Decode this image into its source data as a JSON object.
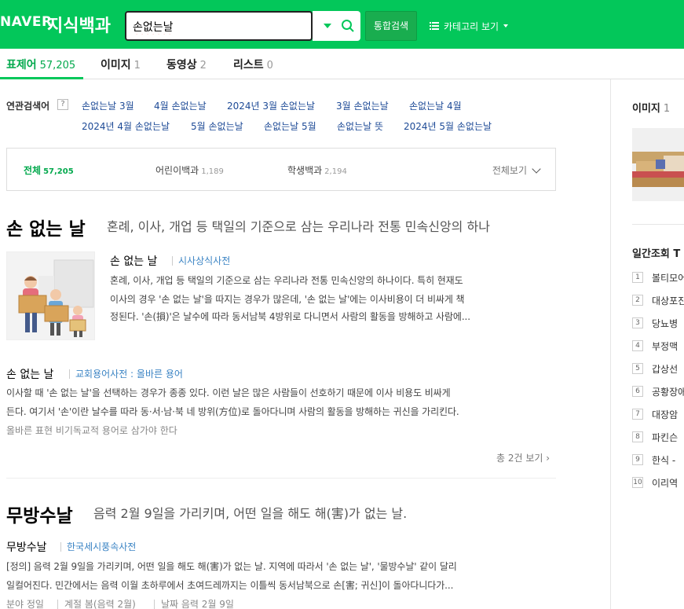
{
  "header": {
    "logo": "NAVER",
    "service": "지식백과",
    "search_value": "손없는날",
    "total_search_label": "통합검색",
    "category_label": "카테고리 보기"
  },
  "tabs": [
    {
      "label": "표제어",
      "count": "57,205"
    },
    {
      "label": "이미지",
      "count": "1"
    },
    {
      "label": "동영상",
      "count": "2"
    },
    {
      "label": "리스트",
      "count": "0"
    }
  ],
  "related": {
    "label": "연관검색어",
    "help": "?",
    "row1": [
      "손없는날 3월",
      "4월 손없는날",
      "2024년 3월 손없는날",
      "3월 손없는날",
      "손없는날 4월"
    ],
    "row2": [
      "2024년 4월 손없는날",
      "5월 손없는날",
      "손없는날 5월",
      "손없는날 뜻",
      "2024년 5월 손없는날"
    ]
  },
  "filter": {
    "items": [
      {
        "label": "전체",
        "count": "57,205"
      },
      {
        "label": "어린이백과",
        "count": "1,189"
      },
      {
        "label": "학생백과",
        "count": "2,194"
      }
    ],
    "view_all": "전체보기"
  },
  "entry1": {
    "title": "손 없는 날",
    "desc": "혼례, 이사, 개업 등 택일의 기준으로 삼는 우리나라 전통 민속신앙의 하나",
    "item1": {
      "title": "손 없는 날",
      "source": "시사상식사전",
      "lines": [
        "혼례, 이사, 개업 등 택일의 기준으로 삼는 우리나라 전통 민속신앙의 하나이다. 특히 현재도",
        "이사의 경우 '손 없는 날'을 따지는 경우가 많은데, '손 없는 날'에는 이사비용이 더 비싸게 책",
        "정된다. '손(損)'은 날수에 따라 동서남북 4방위로 다니면서 사람의 활동을 방해하고 사람에..."
      ]
    },
    "item2": {
      "title": "손 없는 날",
      "source": "교회용어사전 : 올바른 용어",
      "lines": [
        "이사할 때 '손 없는 날'을 선택하는 경우가 종종 있다. 이런 날은 많은 사람들이 선호하기 때문에 이사 비용도 비싸게",
        "든다. 여기서 '손'이란 날수를 따라 동·서·남·북 네 방위(方位)로 돌아다니며 사람의 활동을 방해하는 귀신을 가리킨다."
      ],
      "meta": "올바른 표현  비기독교적 용어로 삼가야 한다"
    },
    "more": "총 2건 보기"
  },
  "entry2": {
    "title": "무방수날",
    "desc": "음력 2월 9일을 가리키며, 어떤 일을 해도 해(害)가 없는 날.",
    "item1": {
      "title": "무방수날",
      "source": "한국세시풍속사전",
      "lines": [
        "[정의] 음력 2월 9일을 가리키며, 어떤 일을 해도 해(害)가 없는 날. 지역에 따라서 '손 없는 날', '물방수날' 같이 달리",
        "일컬어진다. 민간에서는 음력 이월 초하루에서 초여드레까지는 이틀씩 동서남북으로 손[害; 귀신]이 돌아다니다가..."
      ],
      "meta": [
        "분야  정일",
        "계절  봄(음력 2월)",
        "날짜  음력 2월 9일"
      ]
    }
  },
  "right": {
    "image_title": "이미지",
    "image_count": "1",
    "rank_title": "일간조회 T",
    "ranks": [
      {
        "num": "1",
        "label": "볼티모어"
      },
      {
        "num": "2",
        "label": "대상포진"
      },
      {
        "num": "3",
        "label": "당뇨병"
      },
      {
        "num": "4",
        "label": "부정맥"
      },
      {
        "num": "5",
        "label": "갑상선"
      },
      {
        "num": "6",
        "label": "공황장애"
      },
      {
        "num": "7",
        "label": "대장암"
      },
      {
        "num": "8",
        "label": "파킨슨"
      },
      {
        "num": "9",
        "label": "한식 -"
      },
      {
        "num": "10",
        "label": "이리역"
      }
    ]
  },
  "colors": {
    "brand": "#03c75a",
    "link": "#1d4a96",
    "source": "#3b84c4"
  }
}
